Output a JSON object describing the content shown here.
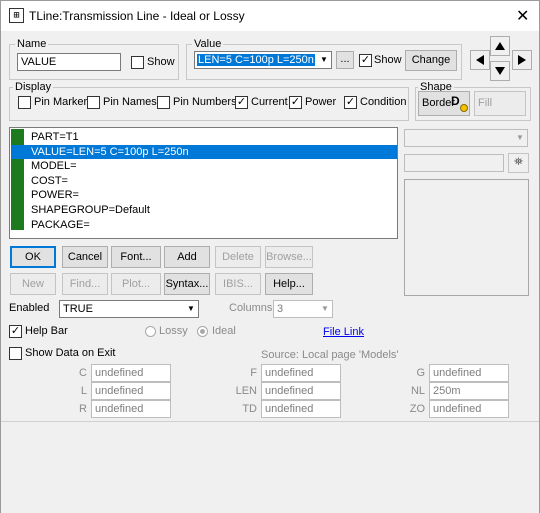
{
  "window": {
    "title": "TLine:Transmission Line - Ideal or Lossy"
  },
  "name_group": {
    "label": "Name",
    "value": "VALUE",
    "show_label": "Show",
    "show_checked": false
  },
  "value_group": {
    "label": "Value",
    "value": "LEN=5 C=100p L=250n",
    "ellipsis_label": "...",
    "show_label": "Show",
    "show_checked": true,
    "change_label": "Change"
  },
  "display_group": {
    "label": "Display",
    "items": [
      {
        "label": "Pin Markers",
        "checked": false
      },
      {
        "label": "Pin Names",
        "checked": false
      },
      {
        "label": "Pin Numbers",
        "checked": false
      },
      {
        "label": "Current",
        "checked": true
      },
      {
        "label": "Power",
        "checked": true
      },
      {
        "label": "Condition",
        "checked": true
      }
    ]
  },
  "shape_group": {
    "label": "Shape",
    "border_label": "Border",
    "fill_label": "Fill"
  },
  "attributes": [
    "PART=T1",
    "VALUE=LEN=5 C=100p L=250n",
    "MODEL=",
    "COST=",
    "POWER=",
    "SHAPEGROUP=Default",
    "PACKAGE="
  ],
  "selected_index": 1,
  "buttons_row1": [
    "OK",
    "Cancel",
    "Font...",
    "Add",
    "Delete",
    "Browse..."
  ],
  "buttons_row2": [
    "New",
    "Find...",
    "Plot...",
    "Syntax...",
    "IBIS...",
    "Help..."
  ],
  "enabled": {
    "label": "Enabled",
    "value": "TRUE"
  },
  "columns": {
    "label": "Columns",
    "value": "3"
  },
  "help_bar": {
    "label": "Help Bar",
    "checked": true
  },
  "lossy_label": "Lossy",
  "ideal_label": "Ideal",
  "file_link": "File Link",
  "show_data": {
    "label": "Show Data on Exit",
    "checked": false
  },
  "source_text": "Source: Local page 'Models'",
  "params": [
    {
      "name": "C",
      "value": "undefined"
    },
    {
      "name": "L",
      "value": "undefined"
    },
    {
      "name": "R",
      "value": "undefined"
    },
    {
      "name": "F",
      "value": "undefined"
    },
    {
      "name": "LEN",
      "value": "undefined"
    },
    {
      "name": "TD",
      "value": "undefined"
    },
    {
      "name": "G",
      "value": "undefined"
    },
    {
      "name": "NL",
      "value": "250m"
    },
    {
      "name": "ZO",
      "value": "undefined"
    }
  ]
}
